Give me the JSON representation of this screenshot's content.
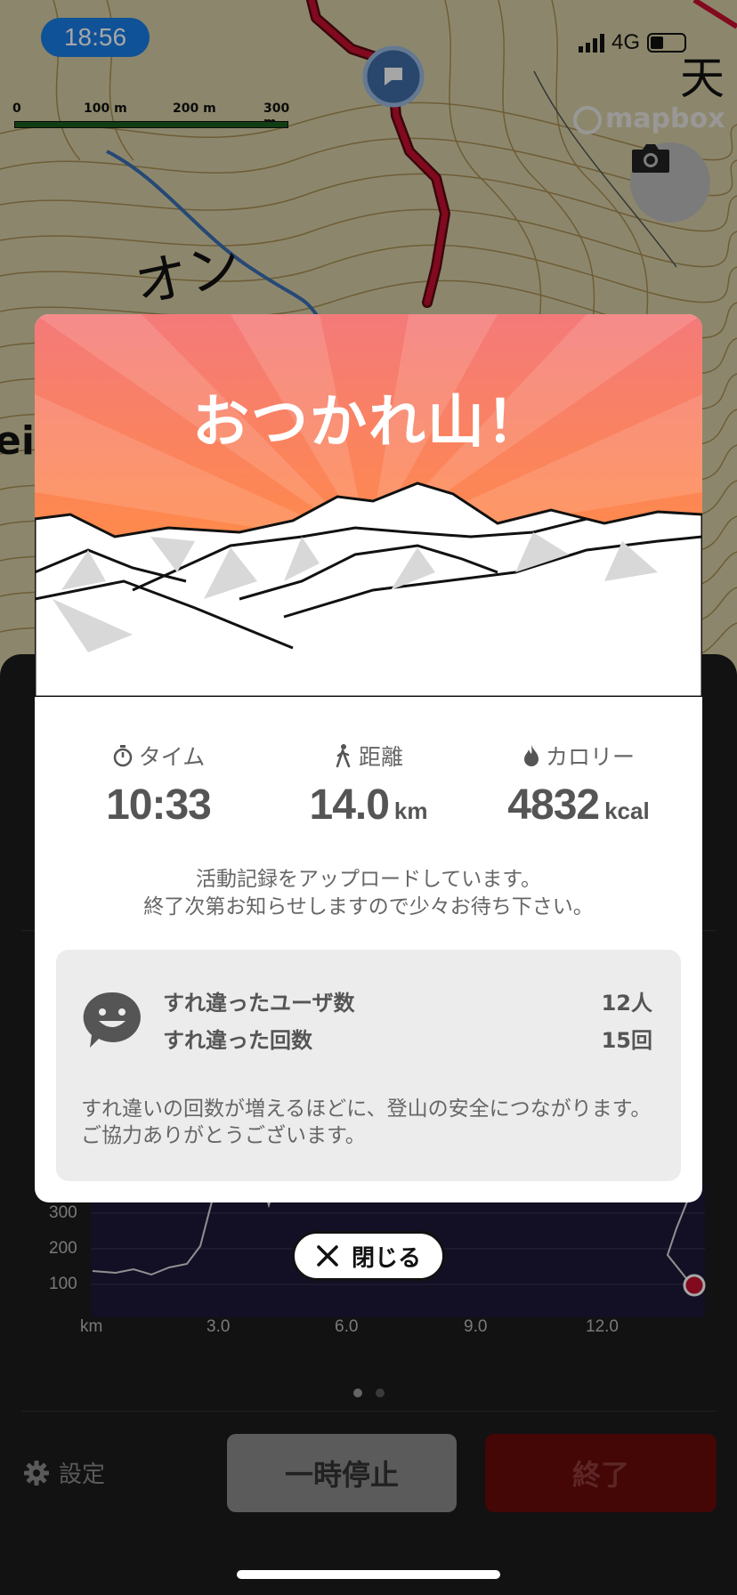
{
  "status_bar": {
    "time": "18:56",
    "network": "4G"
  },
  "map": {
    "scale_ticks": [
      "0",
      "100 m",
      "200 m",
      "300 m"
    ],
    "attribution": "mapbox",
    "label_kanji": "天",
    "label_partial": "eid",
    "label_katakana": "オン",
    "camera_icon": "camera-icon"
  },
  "modal": {
    "title": "おつかれ山！",
    "stats": {
      "time": {
        "label": "タイム",
        "value": "10:33",
        "icon": "stopwatch-icon"
      },
      "distance": {
        "label": "距離",
        "value": "14.0",
        "unit": "km",
        "icon": "hiker-icon"
      },
      "calories": {
        "label": "カロリー",
        "value": "4832",
        "unit": "kcal",
        "icon": "flame-icon"
      }
    },
    "upload_line1": "活動記録をアップロードしています。",
    "upload_line2": "終了次第お知らせしますので少々お待ち下さい。",
    "pass": {
      "users_label": "すれ違ったユーザ数",
      "users_value": "12人",
      "times_label": "すれ違った回数",
      "times_value": "15回",
      "note": "すれ違いの回数が増えるほどに、登山の安全につながります。ご協力ありがとうございます。"
    },
    "close_label": "閉じる"
  },
  "elevation": {
    "y_ticks": [
      "300",
      "200",
      "100"
    ],
    "x_ticks": [
      "km",
      "3.0",
      "6.0",
      "9.0",
      "12.0"
    ]
  },
  "controls": {
    "settings_label": "設定",
    "pause_label": "一時停止",
    "end_label": "終了"
  },
  "colors": {
    "hero_top": "#f47a7a",
    "hero_bottom": "#ff8a2a",
    "route": "#c8102e",
    "end_button": "#6b0a0a"
  }
}
